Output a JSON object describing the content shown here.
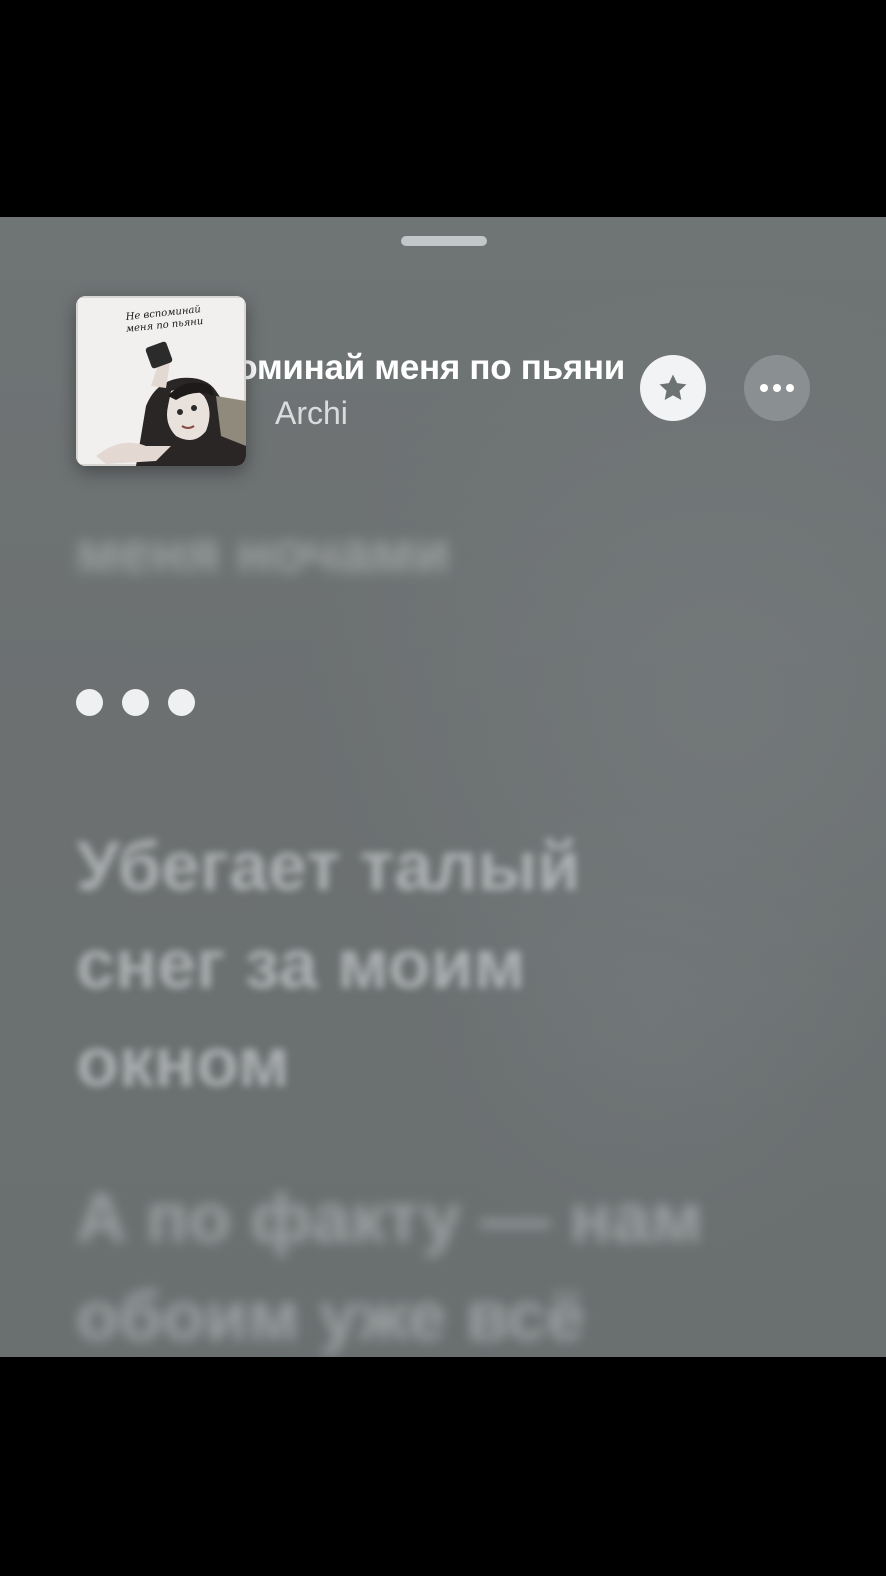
{
  "now_playing": {
    "title": "Не вспоминай меня по пьяни",
    "artist": "Archi",
    "cover_caption": "Не вспоминай меня по пьяни"
  },
  "actions": {
    "favorite_icon": "star-icon",
    "more_icon": "ellipsis-icon"
  },
  "lyrics": {
    "previous_line": "меня ночами",
    "current_indicator": "•••",
    "line_1": "Убегает талый снег за моим окном",
    "line_2": "А по факту — нам обоим уже всё"
  },
  "colors": {
    "background": "#6e7374",
    "accent_light": "#f2f3f4",
    "dot": "#eef0f2"
  }
}
